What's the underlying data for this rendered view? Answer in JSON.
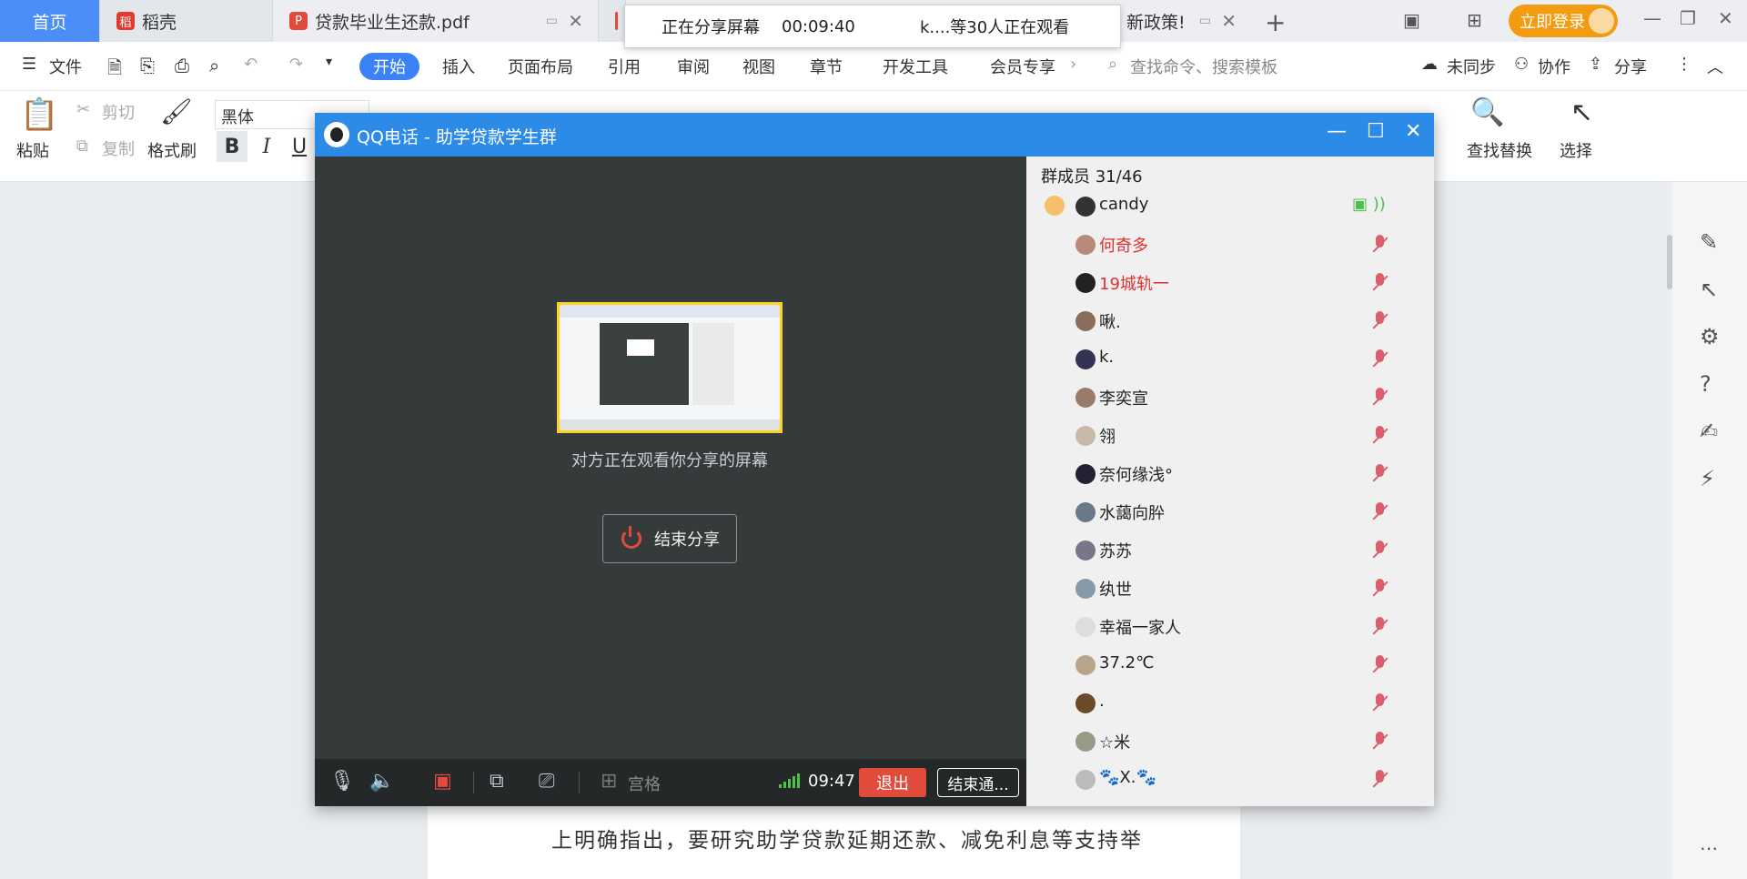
{
  "tabs": {
    "home": "首页",
    "daoke": "稻壳",
    "pdf": "贷款毕业生还款.pdf",
    "policy": "新政策!",
    "login": "立即登录"
  },
  "share_banner": {
    "status": "正在分享屏幕",
    "time": "00:09:40",
    "viewers": "k....等30人正在观看"
  },
  "menu": {
    "file": "文件",
    "start": "开始",
    "insert": "插入",
    "layout": "页面布局",
    "reference": "引用",
    "review": "审阅",
    "view": "视图",
    "chapter": "章节",
    "devtools": "开发工具",
    "member": "会员专享",
    "search_placeholder": "查找命令、搜索模板",
    "unsynced": "未同步",
    "collab": "协作",
    "share": "分享"
  },
  "ribbon": {
    "paste": "粘贴",
    "cut": "剪切",
    "copy": "复制",
    "format_painter": "格式刷",
    "font": "黑体",
    "find_replace": "查找替换",
    "select": "选择"
  },
  "document": {
    "line1": "上明确指出，要研究助学贷款延期还款、减免利息等支持举"
  },
  "qq": {
    "title": "QQ电话 - 助学贷款学生群",
    "viewing_text": "对方正在观看你分享的屏幕",
    "end_share": "结束分享",
    "palace_grid": "宫格",
    "timer": "09:47",
    "exit": "退出",
    "end_call": "结束通...",
    "member_count": "群成员 31/46",
    "members": [
      {
        "name": "candy",
        "color": "#222"
      },
      {
        "name": "何奇多",
        "color": "#e0312e"
      },
      {
        "name": "19城轨一",
        "color": "#e0312e"
      },
      {
        "name": "啾.",
        "color": "#222"
      },
      {
        "name": "k.",
        "color": "#222"
      },
      {
        "name": "李奕宣",
        "color": "#222"
      },
      {
        "name": "翎",
        "color": "#222"
      },
      {
        "name": "奈何缘浅°",
        "color": "#222"
      },
      {
        "name": "水藹向肸",
        "color": "#222"
      },
      {
        "name": "苏苏",
        "color": "#222"
      },
      {
        "name": "纨世",
        "color": "#222"
      },
      {
        "name": "幸福一家人",
        "color": "#222"
      },
      {
        "name": "37.2℃",
        "color": "#222"
      },
      {
        "name": ".",
        "color": "#222"
      },
      {
        "name": "☆米",
        "color": "#222"
      },
      {
        "name": "🐾X.🐾",
        "color": "#222"
      }
    ]
  },
  "colors": {
    "accent": "#2d8be8",
    "exit": "#e04b3c",
    "highlight": "#ffd21f",
    "login": "#f39c12"
  }
}
